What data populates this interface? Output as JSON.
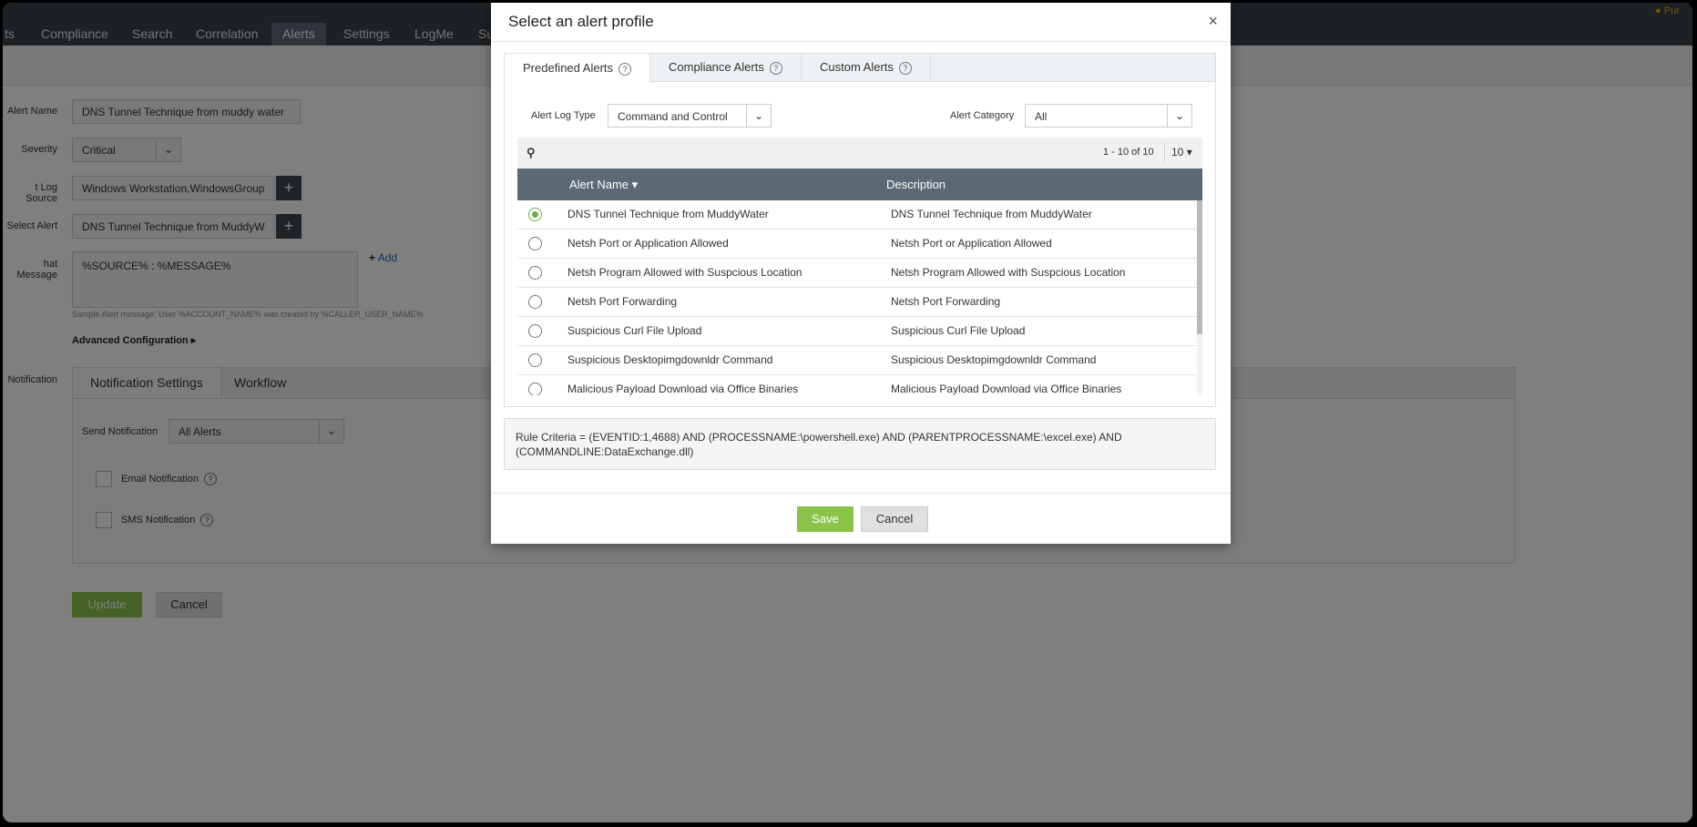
{
  "nav": {
    "tabs": [
      "ts",
      "Compliance",
      "Search",
      "Correlation",
      "Alerts",
      "Settings",
      "LogMe",
      "Su"
    ],
    "active": "Alerts",
    "buy_label": "Pur"
  },
  "form": {
    "alert_name_label": "Alert Name",
    "alert_name_value": "DNS Tunnel Technique from muddy water",
    "severity_label": "Severity",
    "severity_value": "Critical",
    "log_source_label": "t Log Source",
    "log_source_value": "Windows Workstation,WindowsGroup",
    "select_alert_label": "Select Alert",
    "select_alert_value": "DNS Tunnel Technique from MuddyW",
    "format_message_label": "hat Message",
    "format_message_value": "%SOURCE% : %MESSAGE%",
    "add_label": "Add",
    "sample_text": "Sample Alert message: User %ACCOUNT_NAME% was created by %CALLER_USER_NAME%",
    "advanced_label": "Advanced Configuration",
    "notification_label": "Notification",
    "notif_tabs": [
      "Notification Settings",
      "Workflow"
    ],
    "send_notification_label": "Send Notification",
    "send_notification_value": "All Alerts",
    "email_label": "Email Notification",
    "sms_label": "SMS Notification",
    "update_label": "Update",
    "cancel_label": "Cancel"
  },
  "modal": {
    "title": "Select an alert profile",
    "close": "×",
    "tabs": [
      "Predefined Alerts",
      "Compliance Alerts",
      "Custom Alerts"
    ],
    "alert_log_type_label": "Alert Log Type",
    "alert_log_type_value": "Command and Control",
    "alert_category_label": "Alert Category",
    "alert_category_value": "All",
    "pagination": "1 - 10 of 10",
    "page_size": "10",
    "col_name": "Alert Name",
    "col_desc": "Description",
    "rows": [
      {
        "name": "DNS Tunnel Technique from MuddyWater",
        "desc": "DNS Tunnel Technique from MuddyWater",
        "selected": true
      },
      {
        "name": "Netsh Port or Application Allowed",
        "desc": "Netsh Port or Application Allowed",
        "selected": false
      },
      {
        "name": "Netsh Program Allowed with Suspcious Location",
        "desc": "Netsh Program Allowed with Suspcious Location",
        "selected": false
      },
      {
        "name": "Netsh Port Forwarding",
        "desc": "Netsh Port Forwarding",
        "selected": false
      },
      {
        "name": "Suspicious Curl File Upload",
        "desc": "Suspicious Curl File Upload",
        "selected": false
      },
      {
        "name": "Suspicious Desktopimgdownldr Command",
        "desc": "Suspicious Desktopimgdownldr Command",
        "selected": false
      },
      {
        "name": "Malicious Payload Download via Office Binaries",
        "desc": "Malicious Payload Download via Office Binaries",
        "selected": false
      }
    ],
    "criteria": "Rule Criteria = (EVENTID:1,4688) AND (PROCESSNAME:\\powershell.exe) AND (PARENTPROCESSNAME:\\excel.exe) AND (COMMANDLINE:DataExchange.dll)",
    "save_label": "Save",
    "cancel_label": "Cancel"
  },
  "colors": {
    "accent_green": "#8bc34a",
    "nav_dark": "#3b4249",
    "header_grey": "#5c6873"
  }
}
